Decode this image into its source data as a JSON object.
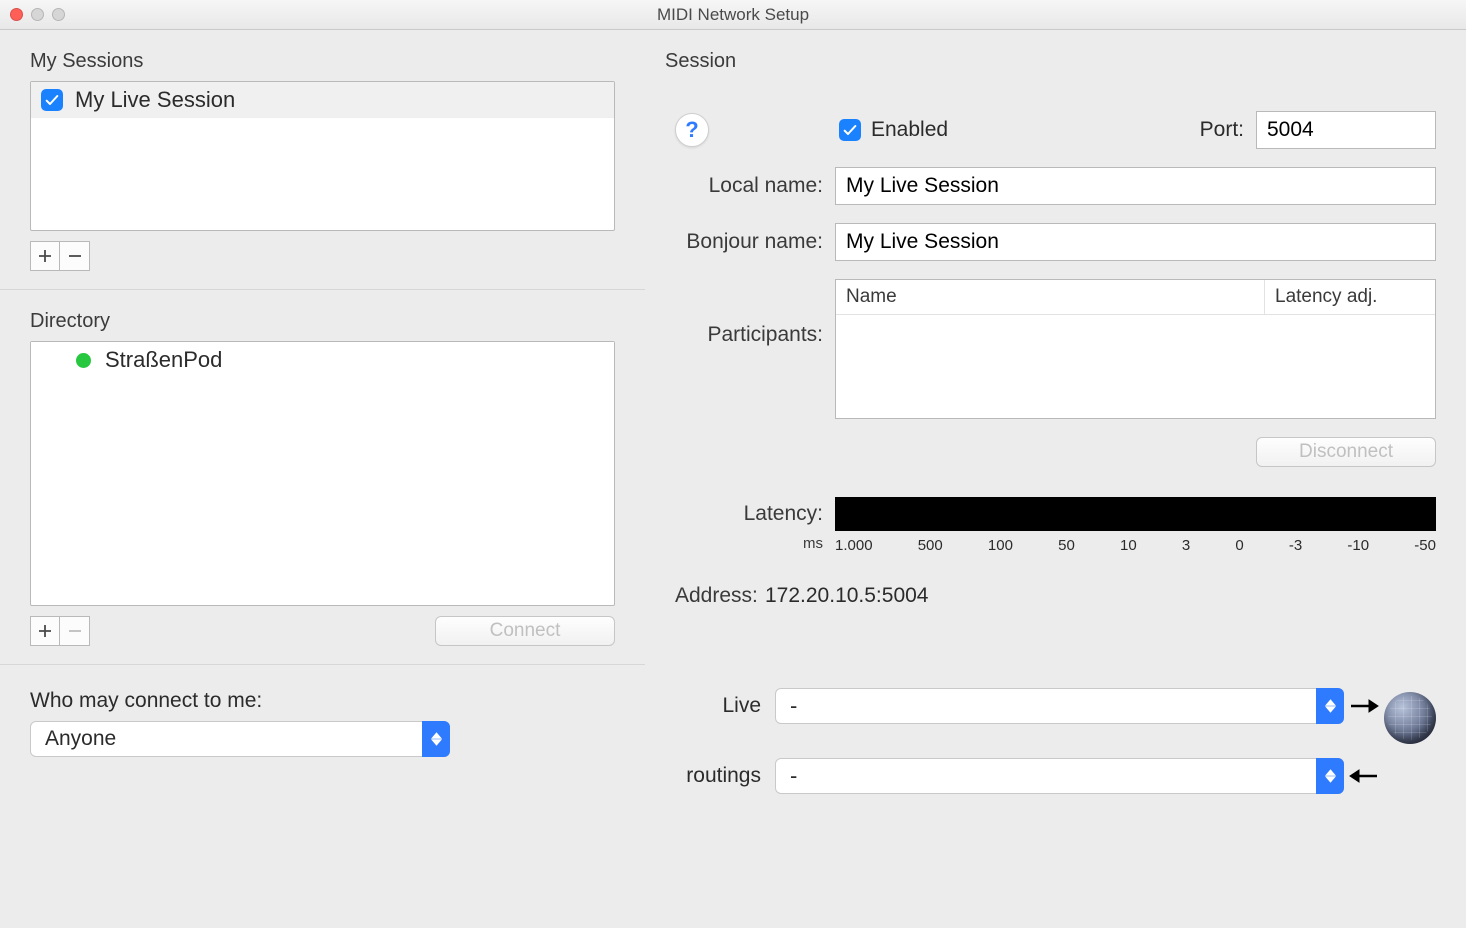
{
  "window": {
    "title": "MIDI Network Setup"
  },
  "left": {
    "sessions_heading": "My Sessions",
    "session_item": "My Live Session",
    "directory_heading": "Directory",
    "directory_item": "StraßenPod",
    "connect_label": "Connect",
    "who_label": "Who may connect to me:",
    "who_value": "Anyone"
  },
  "right": {
    "heading": "Session",
    "help": "?",
    "enabled_label": "Enabled",
    "port_label": "Port:",
    "port_value": "5004",
    "local_name_label": "Local name:",
    "local_name_value": "My Live Session",
    "bonjour_label": "Bonjour name:",
    "bonjour_value": "My Live Session",
    "participants_label": "Participants:",
    "participants_col_name": "Name",
    "participants_col_latency": "Latency adj.",
    "disconnect_label": "Disconnect",
    "latency_label": "Latency:",
    "latency_unit": "ms",
    "latency_ticks": [
      "1.000",
      "500",
      "100",
      "50",
      "10",
      "3",
      "0",
      "-3",
      "-10",
      "-50"
    ],
    "address_label": "Address:",
    "address_value": "172.20.10.5:5004",
    "routings_label_l1": "Live",
    "routings_label_l2": "routings",
    "routing_out": "-",
    "routing_in": "-"
  }
}
